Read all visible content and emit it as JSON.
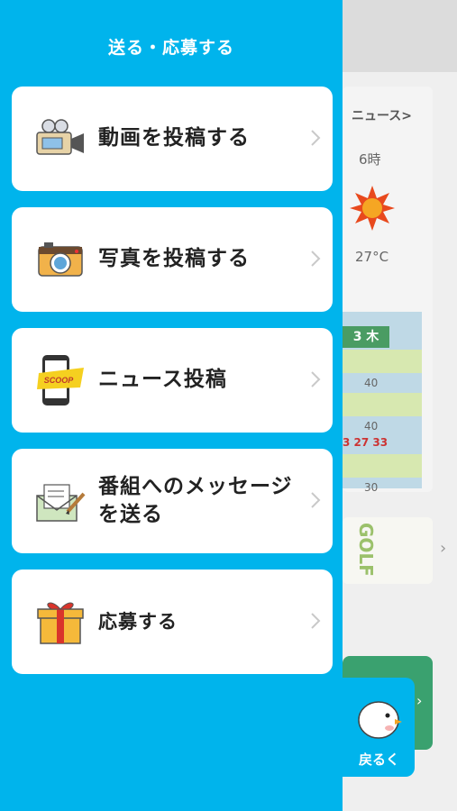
{
  "drawer": {
    "title": "送る・応募する",
    "items": [
      {
        "label": "動画を投稿する",
        "icon": "video-camera-icon"
      },
      {
        "label": "写真を投稿する",
        "icon": "camera-icon"
      },
      {
        "label": "ニュース投稿",
        "icon": "smartphone-scoop-icon",
        "badge": "SCOOP"
      },
      {
        "label": "番組へのメッセージを送る",
        "icon": "envelope-letter-icon"
      },
      {
        "label": "応募する",
        "icon": "gift-box-icon"
      }
    ]
  },
  "background": {
    "news_link": "ニュース>",
    "hour": "6時",
    "temperature": "27°C",
    "rank_label": "3 木",
    "forty_a": "40",
    "forty_b": "40",
    "temps_row": "3 27 33",
    "thirty": "30",
    "golf": "GOLF"
  },
  "back_tab": {
    "label": "戻るく"
  },
  "colors": {
    "accent": "#00b4ec",
    "card": "#ffffff"
  }
}
